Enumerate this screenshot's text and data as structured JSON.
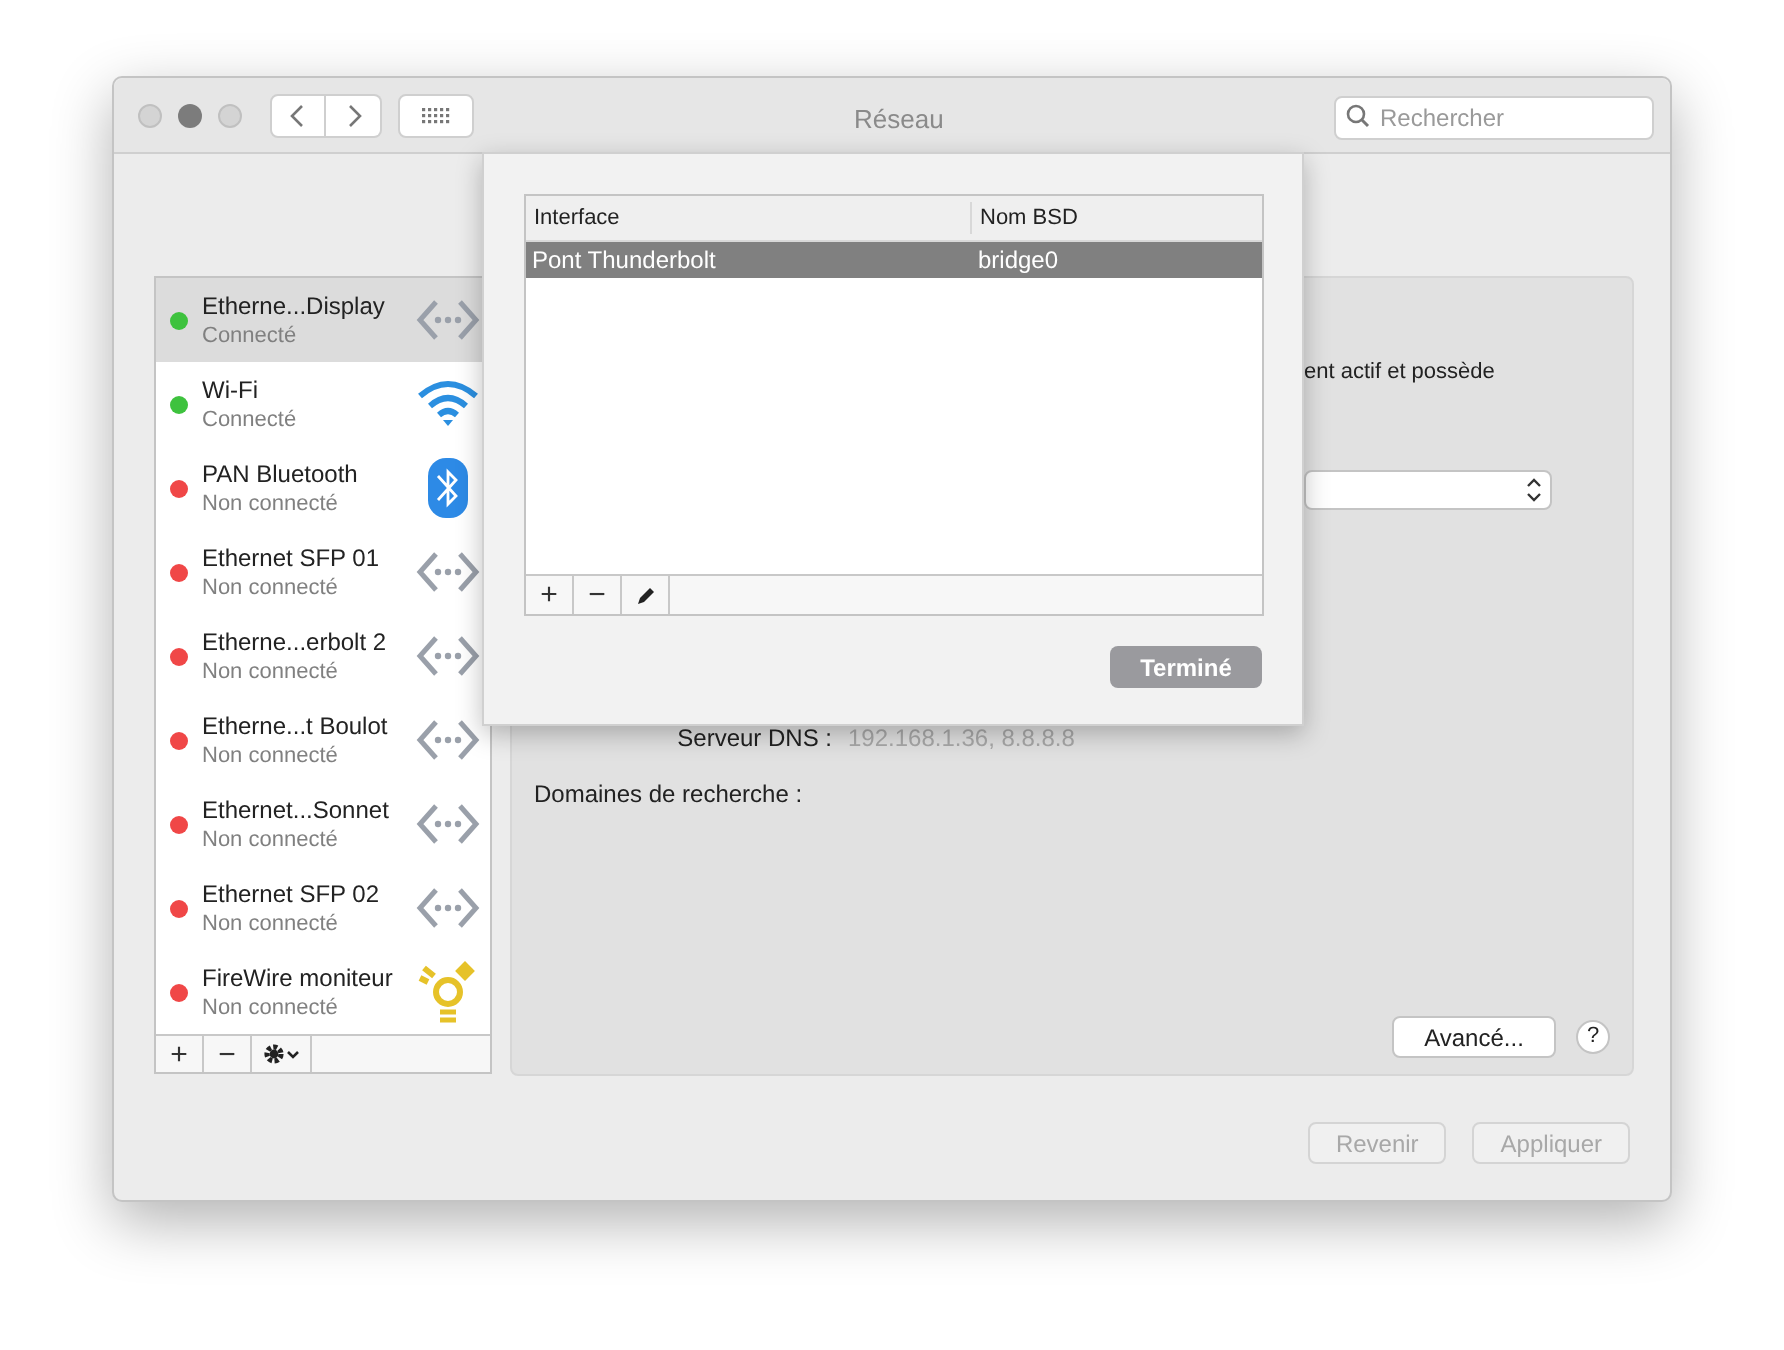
{
  "window": {
    "title": "Réseau"
  },
  "toolbar": {
    "search": {
      "placeholder": "Rechercher"
    }
  },
  "sidebar": {
    "items": [
      {
        "name": "Etherne...Display",
        "status": "Connecté",
        "color": "#3ec23e",
        "kind": "ethernet",
        "selected": true
      },
      {
        "name": "Wi-Fi",
        "status": "Connecté",
        "color": "#3ec23e",
        "kind": "wifi",
        "selected": false
      },
      {
        "name": "PAN Bluetooth",
        "status": "Non connecté",
        "color": "#f04747",
        "kind": "bluetooth",
        "selected": false
      },
      {
        "name": "Ethernet SFP 01",
        "status": "Non connecté",
        "color": "#f04747",
        "kind": "ethernet",
        "selected": false
      },
      {
        "name": "Etherne...erbolt 2",
        "status": "Non connecté",
        "color": "#f04747",
        "kind": "ethernet",
        "selected": false
      },
      {
        "name": "Etherne...t Boulot",
        "status": "Non connecté",
        "color": "#f04747",
        "kind": "ethernet",
        "selected": false
      },
      {
        "name": "Ethernet...Sonnet",
        "status": "Non connecté",
        "color": "#f04747",
        "kind": "ethernet",
        "selected": false
      },
      {
        "name": "Ethernet SFP 02",
        "status": "Non connecté",
        "color": "#f04747",
        "kind": "ethernet",
        "selected": false
      },
      {
        "name": "FireWire moniteur",
        "status": "Non connecté",
        "color": "#f04747",
        "kind": "firewire",
        "selected": false
      }
    ],
    "footer": [
      "+",
      "−"
    ]
  },
  "detail": {
    "status_text": "ent actif et possède",
    "dns_label": "Serveur DNS :",
    "dns_value": "192.168.1.36, 8.8.8.8",
    "search_domains_label": "Domaines de recherche :",
    "advanced_button": "Avancé...",
    "help_button": "?"
  },
  "buttons": [
    {
      "label": "Revenir",
      "disabled": true
    },
    {
      "label": "Appliquer",
      "disabled": true
    }
  ],
  "sheet": {
    "columns": [
      "Interface",
      "Nom BSD"
    ],
    "rows": [
      {
        "cells": [
          "Pont Thunderbolt",
          "bridge0"
        ],
        "selected": true
      }
    ],
    "footer": [
      "+",
      "−"
    ],
    "done_button": "Terminé"
  }
}
